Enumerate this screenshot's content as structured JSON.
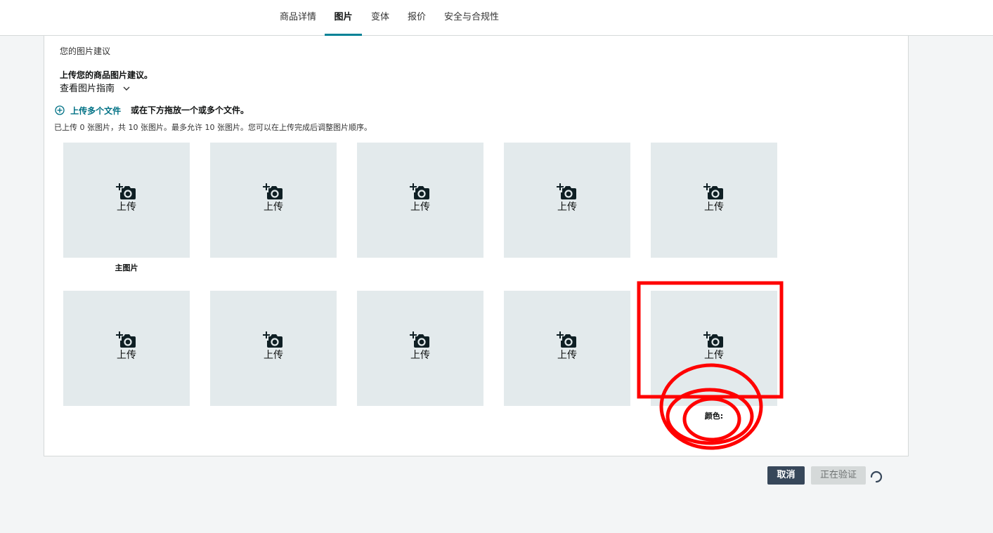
{
  "tabs": [
    {
      "label": "商品详情",
      "active": false
    },
    {
      "label": "图片",
      "active": true
    },
    {
      "label": "变体",
      "active": false
    },
    {
      "label": "报价",
      "active": false
    },
    {
      "label": "安全与合规性",
      "active": false
    }
  ],
  "panel": {
    "suggestions_title": "您的图片建议",
    "upload_suggestion": "上传您的商品图片建议。",
    "guide_link": "查看图片指南",
    "upload_multiple": "上传多个文件",
    "drag_hint": "或在下方拖放一个或多个文件。",
    "status": "已上传 0 张图片，共 10 张图片。最多允许 10 张图片。您可以在上传完成后调整图片顺序。"
  },
  "tiles": [
    {
      "label": "上传",
      "caption": "主图片"
    },
    {
      "label": "上传",
      "caption": ""
    },
    {
      "label": "上传",
      "caption": ""
    },
    {
      "label": "上传",
      "caption": ""
    },
    {
      "label": "上传",
      "caption": ""
    },
    {
      "label": "上传",
      "caption": ""
    },
    {
      "label": "上传",
      "caption": ""
    },
    {
      "label": "上传",
      "caption": ""
    },
    {
      "label": "上传",
      "caption": ""
    },
    {
      "label": "上传",
      "caption": "颜色:"
    }
  ],
  "footer": {
    "cancel_label": "取消",
    "verify_label": "正在验证"
  },
  "colors": {
    "accent": "#008296",
    "link": "#007185",
    "tile_bg": "#e3eaec",
    "annotation": "#ff0000"
  }
}
